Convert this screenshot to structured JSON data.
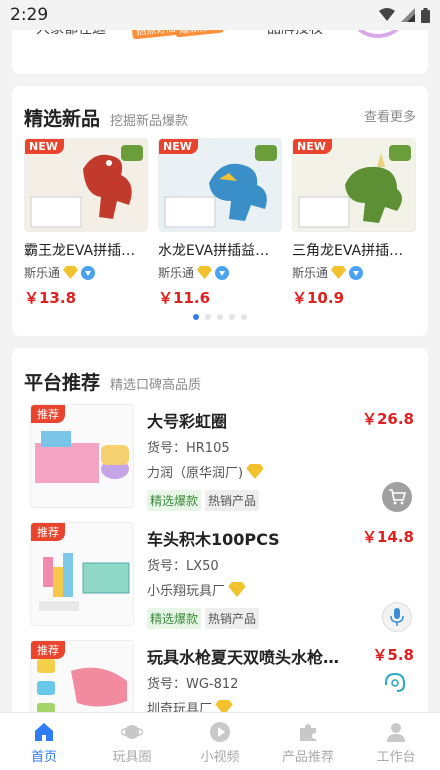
{
  "status_bar": {
    "time": "2:29"
  },
  "top_banner": {
    "left_text": "大家都在逛",
    "badge_a": "热点好店",
    "badge_b": "爆款推荐",
    "right_text": "品牌授权"
  },
  "new_products": {
    "title": "精选新品",
    "subtitle": "挖掘新品爆款",
    "more_label": "查看更多",
    "new_tag": "NEW",
    "items": [
      {
        "name": "霸王龙EVA拼插益智玩具",
        "shop": "斯乐通",
        "price": "￥13.8",
        "color": "#c0392b"
      },
      {
        "name": "水龙EVA拼插益智玩具",
        "shop": "斯乐通",
        "price": "￥11.6",
        "color": "#3a7fb8"
      },
      {
        "name": "三角龙EVA拼插益智玩具",
        "shop": "斯乐通",
        "price": "￥10.9",
        "color": "#5b8a3a"
      }
    ],
    "page_count": 5,
    "page_index": 0
  },
  "platform_recommend": {
    "title": "平台推荐",
    "subtitle": "精选口碑高品质",
    "tag_label": "推荐",
    "items": [
      {
        "name": "大号彩虹圈",
        "code": "货号：HR105",
        "shop": "力润（原华润厂)",
        "price": "￥26.8",
        "tags": [
          "精选爆款",
          "热销产品"
        ]
      },
      {
        "name": "车头积木100PCS",
        "code": "货号：LX50",
        "shop": "小乐翔玩具厂",
        "price": "￥14.8",
        "tags": [
          "精选爆款",
          "热销产品"
        ]
      },
      {
        "name": "玩具水枪夏天双喷头水枪玩具",
        "code": "货号：WG-812",
        "shop": "圳奇玩具厂",
        "price": "￥5.8",
        "tags": []
      }
    ]
  },
  "tabbar": {
    "tabs": [
      {
        "label": "首页",
        "icon": "home-icon",
        "active": true
      },
      {
        "label": "玩具圈",
        "icon": "planet-icon",
        "active": false
      },
      {
        "label": "小视频",
        "icon": "play-icon",
        "active": false
      },
      {
        "label": "产品推荐",
        "icon": "puzzle-icon",
        "active": false
      },
      {
        "label": "工作台",
        "icon": "person-icon",
        "active": false
      }
    ]
  },
  "colors": {
    "accent": "#2f7cf6",
    "price": "#e02020",
    "tag": "#e8442e"
  }
}
